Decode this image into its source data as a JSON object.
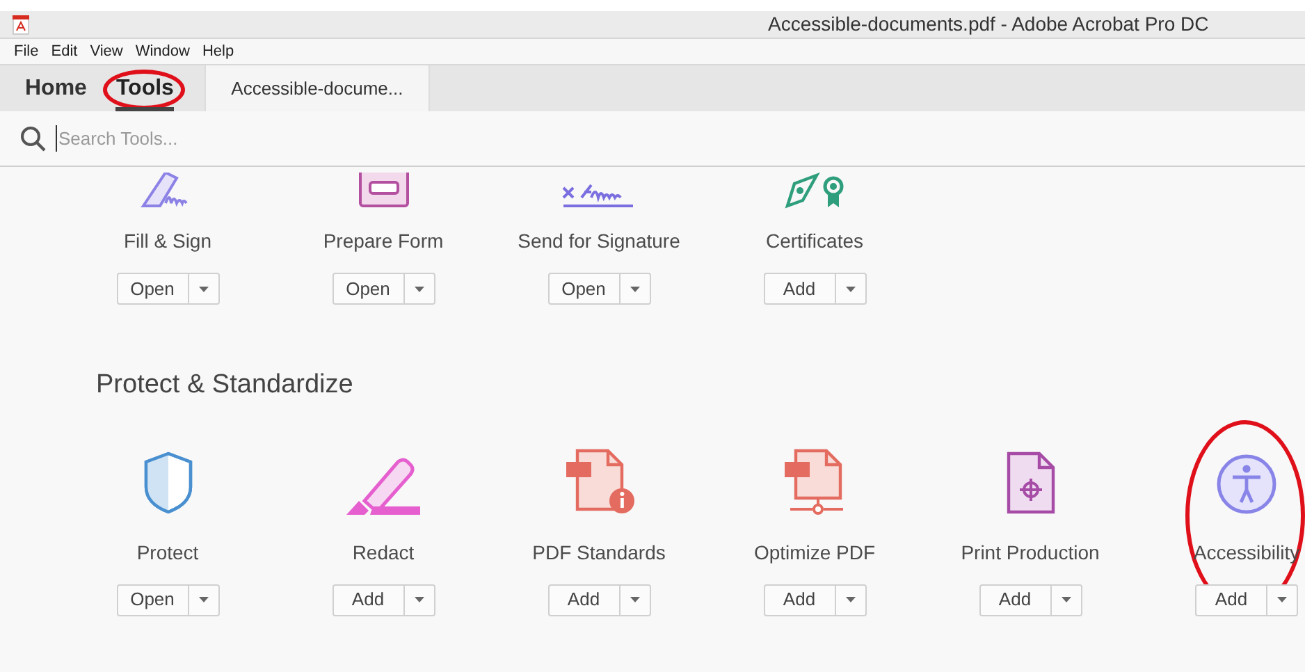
{
  "window": {
    "title": "Accessible-documents.pdf - Adobe Acrobat Pro DC"
  },
  "menu": [
    "File",
    "Edit",
    "View",
    "Window",
    "Help"
  ],
  "tabs": [
    {
      "label": "Home",
      "selected": false,
      "highlighted": false
    },
    {
      "label": "Tools",
      "selected": true,
      "highlighted": true
    }
  ],
  "document_tab": {
    "label": "Accessible-docume..."
  },
  "search": {
    "placeholder": "Search Tools..."
  },
  "sections": [
    {
      "tools": [
        {
          "name": "Fill & Sign",
          "action": "Open",
          "highlighted": false
        },
        {
          "name": "Prepare Form",
          "action": "Open",
          "highlighted": false
        },
        {
          "name": "Send for Signature",
          "action": "Open",
          "highlighted": false
        },
        {
          "name": "Certificates",
          "action": "Add",
          "highlighted": false
        }
      ]
    },
    {
      "title": "Protect & Standardize",
      "tools": [
        {
          "name": "Protect",
          "action": "Open",
          "highlighted": false
        },
        {
          "name": "Redact",
          "action": "Add",
          "highlighted": false
        },
        {
          "name": "PDF Standards",
          "action": "Add",
          "highlighted": false
        },
        {
          "name": "Optimize PDF",
          "action": "Add",
          "highlighted": false
        },
        {
          "name": "Print Production",
          "action": "Add",
          "highlighted": false
        },
        {
          "name": "Accessibility",
          "action": "Add",
          "highlighted": true
        }
      ]
    }
  ]
}
